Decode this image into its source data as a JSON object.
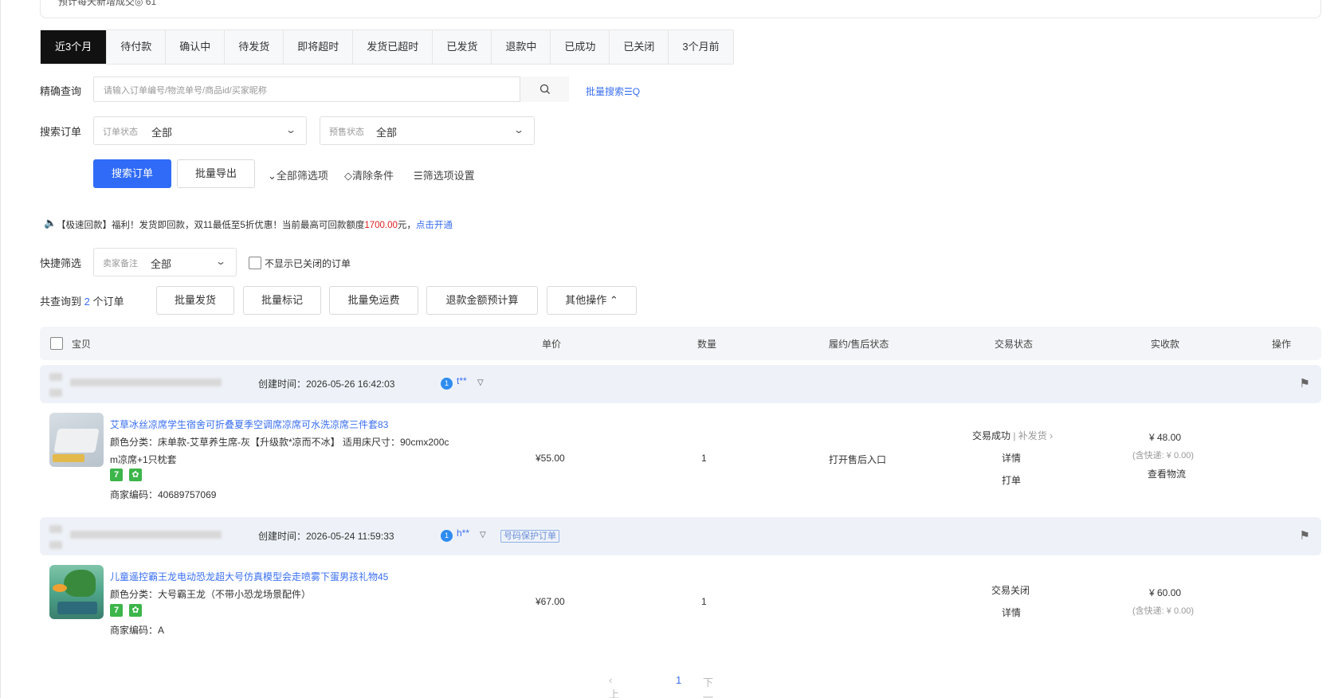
{
  "top": {
    "partial_text": "预计每天新增成交◎  61"
  },
  "tabs": [
    "近3个月",
    "待付款",
    "确认中",
    "待发货",
    "即将超时",
    "发货已超时",
    "已发货",
    "退款中",
    "已成功",
    "已关闭",
    "3个月前"
  ],
  "precise_search": {
    "label": "精确查询",
    "placeholder": "请输入订单编号/物流单号/商品id/买家昵称",
    "batch_search": "批量搜索☰Q"
  },
  "search_orders": {
    "label": "搜索订单",
    "order_status_label": "订单状态",
    "order_status_value": "全部",
    "presale_status_label": "预售状态",
    "presale_status_value": "全部"
  },
  "actions": {
    "search_btn": "搜索订单",
    "export_btn": "批量导出",
    "all_filters": "⌄全部筛选项",
    "clear": "◇清除条件",
    "filter_settings": "☰筛选项设置"
  },
  "notice": {
    "text": "【极速回款】福利！发货即回款，双11最低至5折优惠！当前最高可回款额度",
    "amount": "1700.00",
    "unit": "元，",
    "link": "点击开通"
  },
  "quick_filter": {
    "label": "快捷筛选",
    "remark_label": "卖家备注",
    "remark_value": "全部",
    "hide_closed": "不显示已关闭的订单"
  },
  "summary": {
    "prefix": "共查询到",
    "count": "2",
    "suffix": "个订单"
  },
  "bulk_buttons": [
    "批量发货",
    "批量标记",
    "批量免运费",
    "退款金额预计算",
    "其他操作 ⌃"
  ],
  "table_headers": {
    "item": "宝贝",
    "price": "单价",
    "qty": "数量",
    "after_sale": "履约/售后状态",
    "trade_status": "交易状态",
    "received": "实收款",
    "ops": "操作"
  },
  "orders": [
    {
      "created": "创建时间：2026-05-26 16:42:03",
      "buyer": "t**",
      "title": "艾草冰丝凉席学生宿舍可折叠夏季空调席凉席可水洗凉席三件套83",
      "spec1": "颜色分类：床单款-艾草养生席-灰【升级款*凉而不冰】  适用床尺寸：90cmx200c",
      "spec2": "m凉席+1只枕套",
      "code": "商家编码：40689757069",
      "price": "¥55.00",
      "qty": "1",
      "after_sale": "打开售后入口",
      "status": "交易成功",
      "status_extra": "| 补发货 ›",
      "detail": "详情",
      "print": "打单",
      "received": "¥ 48.00",
      "shipping": "(含快递: ¥ 0.00)",
      "logistics": "查看物流"
    },
    {
      "created": "创建时间：2026-05-24 11:59:33",
      "buyer": "h**",
      "protected": "号码保护订单",
      "title": "儿童遥控霸王龙电动恐龙超大号仿真模型会走喷雾下蛋男孩礼物45",
      "spec1": "颜色分类：大号霸王龙（不带小恐龙场景配件）",
      "code": "商家编码：A",
      "price": "¥67.00",
      "qty": "1",
      "status": "交易关闭",
      "detail": "详情",
      "received": "¥ 60.00",
      "shipping": "(含快递: ¥ 0.00)"
    }
  ],
  "pager": {
    "prev": "‹ 上一页",
    "page": "1",
    "next": "下一页 ›"
  },
  "colors": {
    "primary": "#2f6bf6",
    "link": "#3a6ff0",
    "active_tab": "#111111",
    "notice_red": "#e02020",
    "badge_green": "#3cb54a"
  }
}
